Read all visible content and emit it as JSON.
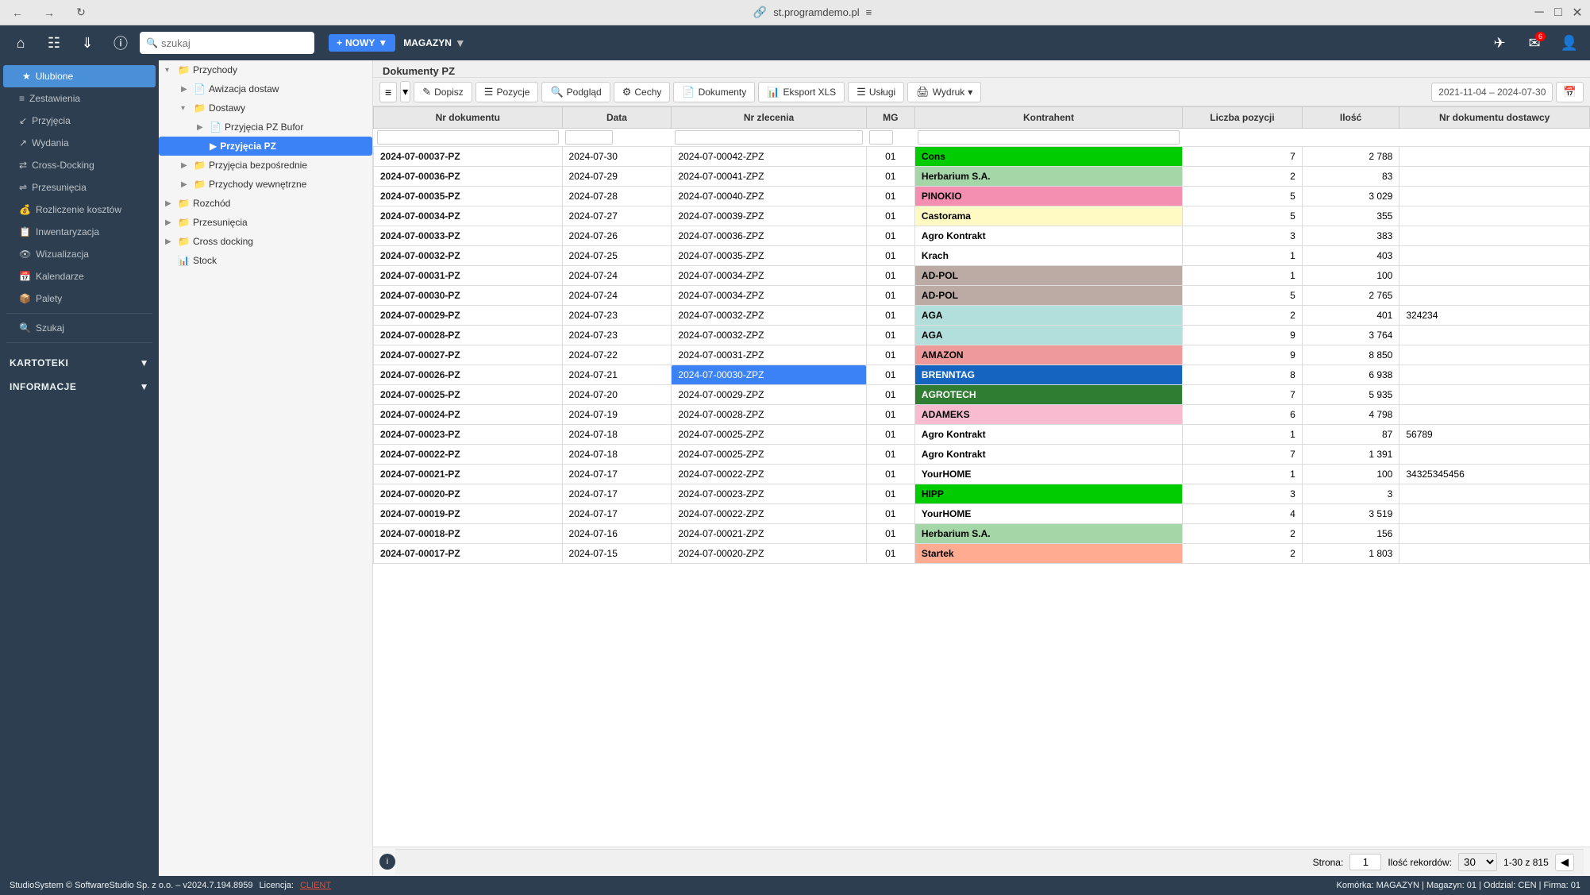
{
  "titleBar": {
    "url": "st.programdemo.pl",
    "navButtons": [
      "back",
      "forward",
      "refresh"
    ]
  },
  "topToolbar": {
    "search_placeholder": "szukaj",
    "new_label": "NOWY",
    "magazine_label": "MAGAZYN"
  },
  "statusBar": {
    "copyright": "StudioSystem © SoftwareStudio Sp. z o.o. – v2024.7.194.8959",
    "license_label": "Licencja:",
    "license_value": "CLIENT",
    "cell_info": "Komórka: MAGAZYN | Magazyn: 01 | Oddzial: CEN | Firma: 01"
  },
  "leftSidebar": {
    "items": [
      {
        "id": "ulubione",
        "label": "Ulubione",
        "active": true
      },
      {
        "id": "zestawienia",
        "label": "Zestawienia"
      },
      {
        "id": "przyjecia",
        "label": "Przyjęcia"
      },
      {
        "id": "wydania",
        "label": "Wydania"
      },
      {
        "id": "cross-docking",
        "label": "Cross-Docking"
      },
      {
        "id": "przesunecia",
        "label": "Przesunięcia"
      },
      {
        "id": "rozliczenie",
        "label": "Rozliczenie kosztów"
      },
      {
        "id": "inwentaryzacja",
        "label": "Inwentaryzacja"
      },
      {
        "id": "wizualizacja",
        "label": "Wizualizacja"
      },
      {
        "id": "kalendarze",
        "label": "Kalendarze"
      },
      {
        "id": "palety",
        "label": "Palety"
      },
      {
        "id": "szukaj",
        "label": "Szukaj"
      },
      {
        "id": "kartoteki",
        "label": "KARTOTEKI"
      },
      {
        "id": "informacje",
        "label": "INFORMACJE"
      }
    ]
  },
  "navTree": {
    "items": [
      {
        "id": "przychody",
        "label": "Przychody",
        "level": 0,
        "expanded": true,
        "arrow": "▾",
        "icon": "📁"
      },
      {
        "id": "awizacja",
        "label": "Awizacja dostaw",
        "level": 1,
        "arrow": "▶",
        "icon": "📄"
      },
      {
        "id": "dostawy",
        "label": "Dostawy",
        "level": 1,
        "expanded": true,
        "arrow": "▾",
        "icon": "📁"
      },
      {
        "id": "przyjecia-bufor",
        "label": "Przyjęcia PZ Bufor",
        "level": 2,
        "arrow": "▶",
        "icon": "📄"
      },
      {
        "id": "przyjecia-pz",
        "label": "Przyjęcia PZ",
        "level": 2,
        "selected": true,
        "arrow": "",
        "icon": "📄"
      },
      {
        "id": "przyjecia-bezp",
        "label": "Przyjęcia bezpośrednie",
        "level": 1,
        "arrow": "▶",
        "icon": "📁"
      },
      {
        "id": "przychody-wewn",
        "label": "Przychody wewnętrzne",
        "level": 1,
        "arrow": "▶",
        "icon": "📁"
      },
      {
        "id": "rozchod",
        "label": "Rozchód",
        "level": 0,
        "arrow": "▶",
        "icon": "📁"
      },
      {
        "id": "przesunecia",
        "label": "Przesunięcia",
        "level": 0,
        "arrow": "▶",
        "icon": "📁"
      },
      {
        "id": "cross-docking",
        "label": "Cross docking",
        "level": 0,
        "arrow": "▶",
        "icon": "📁"
      },
      {
        "id": "stock",
        "label": "Stock",
        "level": 0,
        "arrow": "",
        "icon": "📊"
      }
    ]
  },
  "documentPanel": {
    "title": "Dokumenty PZ",
    "toolbar": {
      "hamburger": "≡",
      "buttons": [
        {
          "id": "dopisz",
          "icon": "✏",
          "label": "Dopisz"
        },
        {
          "id": "pozycje",
          "icon": "☰",
          "label": "Pozycje"
        },
        {
          "id": "podglad",
          "icon": "🔍",
          "label": "Podgląd"
        },
        {
          "id": "cechy",
          "icon": "⚙",
          "label": "Cechy"
        },
        {
          "id": "dokumenty",
          "icon": "📄",
          "label": "Dokumenty"
        },
        {
          "id": "eksport",
          "icon": "📊",
          "label": "Eksport XLS"
        },
        {
          "id": "uslugi",
          "icon": "☰",
          "label": "Usługi"
        },
        {
          "id": "wydruk",
          "icon": "🖨",
          "label": "Wydruk"
        }
      ],
      "date_range": "2021-11-04 – 2024-07-30"
    },
    "table": {
      "headers": [
        "Nr dokumentu",
        "Data",
        "Nr zlecenia",
        "MG",
        "Kontrahent",
        "Liczba pozycji",
        "Ilość",
        "Nr dokumentu dostawcy"
      ],
      "filter_row": [
        "",
        "",
        "",
        "",
        "",
        "",
        "",
        ""
      ],
      "rows": [
        {
          "doc": "2024-07-00037-PZ",
          "date": "2024-07-30",
          "order": "2024-07-00042-ZPZ",
          "mg": "01",
          "contractor": "Cons",
          "pos": 7,
          "qty": "2 788",
          "docnum": "",
          "color": "row-green-bright"
        },
        {
          "doc": "2024-07-00036-PZ",
          "date": "2024-07-29",
          "order": "2024-07-00041-ZPZ",
          "mg": "01",
          "contractor": "Herbarium S.A.",
          "pos": 2,
          "qty": "83",
          "docnum": "",
          "color": "row-green-light"
        },
        {
          "doc": "2024-07-00035-PZ",
          "date": "2024-07-28",
          "order": "2024-07-00040-ZPZ",
          "mg": "01",
          "contractor": "PINOKIO",
          "pos": 5,
          "qty": "3 029",
          "docnum": "",
          "color": "row-pink"
        },
        {
          "doc": "2024-07-00034-PZ",
          "date": "2024-07-27",
          "order": "2024-07-00039-ZPZ",
          "mg": "01",
          "contractor": "Castorama",
          "pos": 5,
          "qty": "355",
          "docnum": "",
          "color": "row-yellow"
        },
        {
          "doc": "2024-07-00033-PZ",
          "date": "2024-07-26",
          "order": "2024-07-00036-ZPZ",
          "mg": "01",
          "contractor": "Agro Kontrakt",
          "pos": 3,
          "qty": "383",
          "docnum": "",
          "color": "row-white"
        },
        {
          "doc": "2024-07-00032-PZ",
          "date": "2024-07-25",
          "order": "2024-07-00035-ZPZ",
          "mg": "01",
          "contractor": "Krach",
          "pos": 1,
          "qty": "403",
          "docnum": "",
          "color": "row-white"
        },
        {
          "doc": "2024-07-00031-PZ",
          "date": "2024-07-24",
          "order": "2024-07-00034-ZPZ",
          "mg": "01",
          "contractor": "AD-POL",
          "pos": 1,
          "qty": "100",
          "docnum": "",
          "color": "row-tan"
        },
        {
          "doc": "2024-07-00030-PZ",
          "date": "2024-07-24",
          "order": "2024-07-00034-ZPZ",
          "mg": "01",
          "contractor": "AD-POL",
          "pos": 5,
          "qty": "2 765",
          "docnum": "",
          "color": "row-tan"
        },
        {
          "doc": "2024-07-00029-PZ",
          "date": "2024-07-23",
          "order": "2024-07-00032-ZPZ",
          "mg": "01",
          "contractor": "AGA",
          "pos": 2,
          "qty": "401",
          "docnum": "324234",
          "color": "row-teal"
        },
        {
          "doc": "2024-07-00028-PZ",
          "date": "2024-07-23",
          "order": "2024-07-00032-ZPZ",
          "mg": "01",
          "contractor": "AGA",
          "pos": 9,
          "qty": "3 764",
          "docnum": "",
          "color": "row-teal"
        },
        {
          "doc": "2024-07-00027-PZ",
          "date": "2024-07-22",
          "order": "2024-07-00031-ZPZ",
          "mg": "01",
          "contractor": "AMAZON",
          "pos": 9,
          "qty": "8 850",
          "docnum": "",
          "color": "row-red"
        },
        {
          "doc": "2024-07-00026-PZ",
          "date": "2024-07-21",
          "order": "2024-07-00030-ZPZ",
          "mg": "01",
          "contractor": "BRENNTAG",
          "pos": 8,
          "qty": "6 938",
          "docnum": "",
          "color": "row-blue-dark",
          "order_selected": true
        },
        {
          "doc": "2024-07-00025-PZ",
          "date": "2024-07-20",
          "order": "2024-07-00029-ZPZ",
          "mg": "01",
          "contractor": "AGROTECH",
          "pos": 7,
          "qty": "5 935",
          "docnum": "",
          "color": "row-dark-green"
        },
        {
          "doc": "2024-07-00024-PZ",
          "date": "2024-07-19",
          "order": "2024-07-00028-ZPZ",
          "mg": "01",
          "contractor": "ADAMEKS",
          "pos": 6,
          "qty": "4 798",
          "docnum": "",
          "color": "row-pink"
        },
        {
          "doc": "2024-07-00023-PZ",
          "date": "2024-07-18",
          "order": "2024-07-00025-ZPZ",
          "mg": "01",
          "contractor": "Agro Kontrakt",
          "pos": 1,
          "qty": "87",
          "docnum": "56789",
          "color": "row-white"
        },
        {
          "doc": "2024-07-00022-PZ",
          "date": "2024-07-18",
          "order": "2024-07-00025-ZPZ",
          "mg": "01",
          "contractor": "Agro Kontrakt",
          "pos": 7,
          "qty": "1 391",
          "docnum": "",
          "color": "row-white"
        },
        {
          "doc": "2024-07-00021-PZ",
          "date": "2024-07-17",
          "order": "2024-07-00022-ZPZ",
          "mg": "01",
          "contractor": "YourHOME",
          "pos": 1,
          "qty": "100",
          "docnum": "34325345456",
          "color": "row-white"
        },
        {
          "doc": "2024-07-00020-PZ",
          "date": "2024-07-17",
          "order": "2024-07-00023-ZPZ",
          "mg": "01",
          "contractor": "HIPP",
          "pos": 3,
          "qty": "3",
          "docnum": "",
          "color": "row-green-bright"
        },
        {
          "doc": "2024-07-00019-PZ",
          "date": "2024-07-17",
          "order": "2024-07-00022-ZPZ",
          "mg": "01",
          "contractor": "YourHOME",
          "pos": 4,
          "qty": "3 519",
          "docnum": "",
          "color": "row-white"
        },
        {
          "doc": "2024-07-00018-PZ",
          "date": "2024-07-16",
          "order": "2024-07-00021-ZPZ",
          "mg": "01",
          "contractor": "Herbarium S.A.",
          "pos": 2,
          "qty": "156",
          "docnum": "",
          "color": "row-green-light"
        },
        {
          "doc": "2024-07-00017-PZ",
          "date": "2024-07-15",
          "order": "2024-07-00020-ZPZ",
          "mg": "01",
          "contractor": "Startek",
          "pos": 2,
          "qty": "1 803",
          "docnum": "",
          "color": "row-salmon"
        }
      ]
    },
    "pagination": {
      "page_label": "Strona:",
      "page": "1",
      "records_label": "Ilość rekordów:",
      "records_per_page": "30",
      "records_range": "1-30 z 815"
    }
  },
  "contractorColors": {
    "Cons": "#00cc00",
    "Herbarium S.A.": "#90EE90",
    "PINOKIO": "#FFB6C1",
    "Castorama": "#FFFACD",
    "AD-POL": "#D2B48C",
    "AGA": "#b2dfdb",
    "AMAZON": "#FF6B6B",
    "BRENNTAG": "#1565c0",
    "AGROTECH": "#2e7d32",
    "ADAMEKS": "#FFB6C1",
    "HIPP": "#00cc00",
    "Startek": "#FFA07A"
  }
}
